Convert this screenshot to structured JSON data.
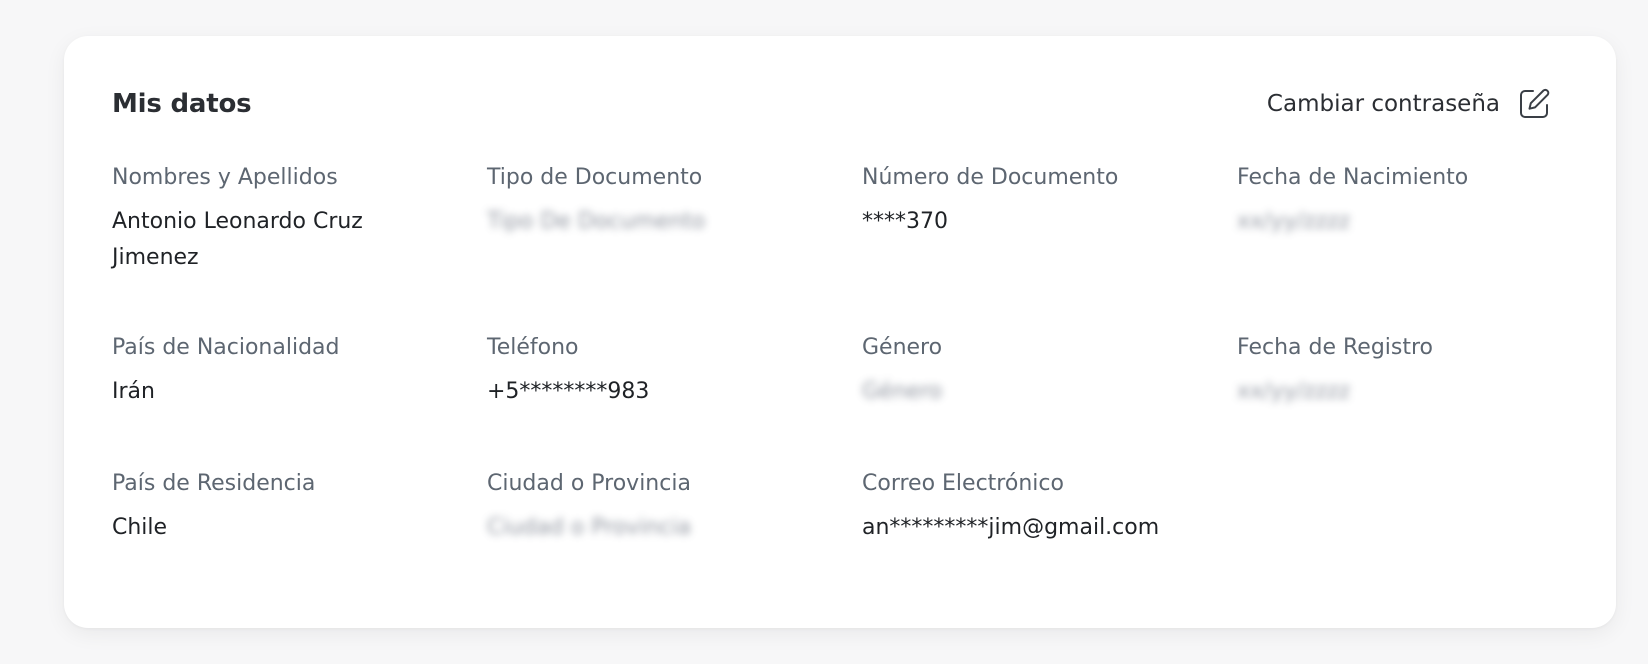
{
  "card": {
    "title": "Mis datos",
    "change_password_label": "Cambiar contraseña",
    "edit_icon": "edit-icon"
  },
  "fields": {
    "full_name": {
      "label": "Nombres y Apellidos",
      "value": "Antonio Leonardo Cruz Jimenez"
    },
    "document_type": {
      "label": "Tipo de Documento",
      "value": "Tipo De Documento"
    },
    "document_number": {
      "label": "Número de Documento",
      "value": "****370"
    },
    "birth_date": {
      "label": "Fecha de Nacimiento",
      "value": "xx/yy/zzzz"
    },
    "nationality": {
      "label": "País de Nacionalidad",
      "value": "Irán"
    },
    "phone": {
      "label": "Teléfono",
      "value": "+5********983"
    },
    "gender": {
      "label": "Género",
      "value": "Género"
    },
    "registration_date": {
      "label": "Fecha de Registro",
      "value": "xx/yy/zzzz"
    },
    "residence_country": {
      "label": "País de Residencia",
      "value": "Chile"
    },
    "city_province": {
      "label": "Ciudad o Provincia",
      "value": "Ciudad o Provincia"
    },
    "email": {
      "label": "Correo Electrónico",
      "value": "an*********jim@gmail.com"
    }
  },
  "colors": {
    "label": "#5d6671",
    "value": "#1f2226",
    "title": "#2b2e33",
    "card_background": "#ffffff",
    "page_background": "#f7f7f8"
  }
}
